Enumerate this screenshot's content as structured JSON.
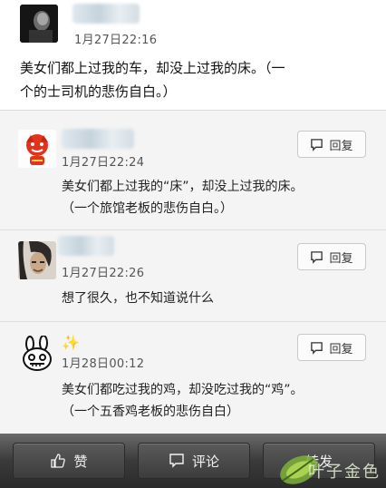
{
  "post": {
    "time": "1月27日22:16",
    "text_line1": "美女们都上过我的车，却没上过我的床。（一",
    "text_line2": "个的士司机的悲伤自白。）"
  },
  "comments": [
    {
      "time": "1月27日22:24",
      "line1": "美女们都上过我的“床”，却没上过我的床。",
      "line2": "（一个旅馆老板的悲伤自白。）",
      "reply_label": "回复",
      "avatar": "red-character-avatar"
    },
    {
      "time": "1月27日22:26",
      "line1": "想了很久，也不知道说什么",
      "line2": "",
      "reply_label": "回复",
      "avatar": "man-portrait-avatar"
    },
    {
      "time": "1月28日00:12",
      "line1": "美女们都吃过我的鸡，却没吃过我的“鸡”。",
      "line2": "（一个五香鸡老板的悲伤自白）",
      "reply_label": "回复",
      "avatar": "bunny-cartoon-avatar"
    }
  ],
  "bottom_bar": {
    "like_label": "赞",
    "comment_label": "评论",
    "more_label": "转发"
  },
  "watermark": {
    "text": "叶子金色"
  },
  "colors": {
    "bar_dark": "#3a3a3a",
    "comment_bg": "#f4f4f4",
    "border": "#c9c9c9"
  }
}
